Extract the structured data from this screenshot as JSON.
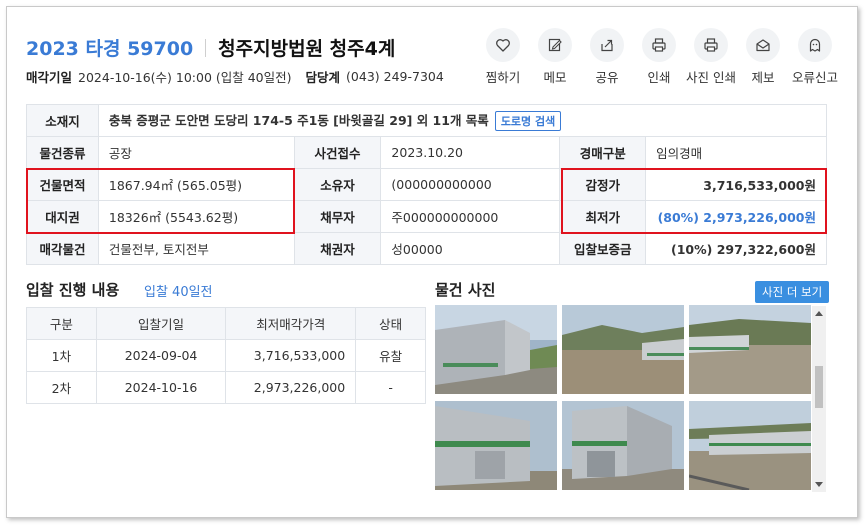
{
  "header": {
    "case_no": "2023 타경 59700",
    "court": "청주지방법원 청주4계",
    "sale_date_label": "매각기일",
    "sale_date_value": "2024-10-16(수) 10:00 (입찰 40일전)",
    "dept_label": "담당계",
    "dept_value": "(043) 249-7304"
  },
  "actions": [
    {
      "label": "찜하기",
      "icon": "heart-icon"
    },
    {
      "label": "메모",
      "icon": "edit-icon"
    },
    {
      "label": "공유",
      "icon": "share-icon"
    },
    {
      "label": "인쇄",
      "icon": "print-icon"
    },
    {
      "label": "사진 인쇄",
      "icon": "print-icon"
    },
    {
      "label": "제보",
      "icon": "mail-icon"
    },
    {
      "label": "오류신고",
      "icon": "ghost-icon"
    }
  ],
  "info": {
    "location_label": "소재지",
    "location_value": "충북 증평군 도안면 도당리 174-5 주1동 [바윗골길 29] 외 11개 목록",
    "road_btn": "도로명 검색",
    "type_label": "물건종류",
    "type_value": "공장",
    "receipt_label": "사건접수",
    "receipt_value": "2023.10.20",
    "auction_type_label": "경매구분",
    "auction_type_value": "임의경매",
    "building_area_label": "건물면적",
    "building_area_value": "1867.94㎡ (565.05평)",
    "owner_label": "소유자",
    "owner_value": "(000000000000",
    "appraisal_label": "감정가",
    "appraisal_value": "3,716,533,000원",
    "land_label": "대지권",
    "land_value": "18326㎡ (5543.62평)",
    "debtor_label": "채무자",
    "debtor_value": "주000000000000",
    "min_price_label": "최저가",
    "min_price_value": "(80%) 2,973,226,000원",
    "sale_items_label": "매각물건",
    "sale_items_value": "건물전부, 토지전부",
    "creditor_label": "채권자",
    "creditor_value": "성00000",
    "deposit_label": "입찰보증금",
    "deposit_value": "(10%) 297,322,600원"
  },
  "bid": {
    "title": "입찰 진행 내용",
    "subtitle": "입찰 40일전",
    "columns": [
      "구분",
      "입찰기일",
      "최저매각가격",
      "상태"
    ],
    "rows": [
      [
        "1차",
        "2024-09-04",
        "3,716,533,000",
        "유찰"
      ],
      [
        "2차",
        "2024-10-16",
        "2,973,226,000",
        "-"
      ]
    ]
  },
  "photos": {
    "title": "물건 사진",
    "more_btn": "사진 더 보기"
  },
  "colors": {
    "accent": "#3a7bd5",
    "highlight": "#e0131e",
    "header_bg": "#f4f6f9"
  }
}
